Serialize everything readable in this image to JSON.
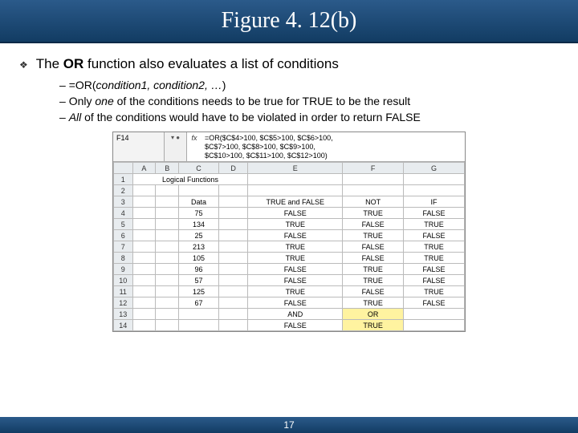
{
  "title": "Figure 4. 12(b)",
  "bullet": {
    "prefix": "The ",
    "bold": "OR",
    "suffix": " function also evaluates a list of conditions"
  },
  "sub": [
    {
      "t1": "=OR(",
      "i1": "condition1, condition2, …",
      "t2": ")"
    },
    {
      "t1": "Only ",
      "i1": "one",
      "t2": " of the conditions needs to be true for TRUE to be the result"
    },
    {
      "t1": "",
      "i1": "All",
      "t2": " of the conditions would have to be violated in order to return FALSE"
    }
  ],
  "fx": {
    "cellref": "F14",
    "ctrl": "▾ ●",
    "label": "fx",
    "formula": "=OR($C$4>100, $C$5>100, $C$6>100,\n$C$7>100, $C$8>100, $C$9>100,\n$C$10>100, $C$11>100, $C$12>100)"
  },
  "sheet": {
    "colhdrs": [
      "A",
      "B",
      "C",
      "D",
      "E",
      "F",
      "G"
    ],
    "rows": [
      {
        "n": "1",
        "a": "Logical Functions",
        "c": "",
        "e": "",
        "f": "",
        "g": "",
        "span": 4
      },
      {
        "n": "2",
        "c": "",
        "e": "",
        "f": "",
        "g": ""
      },
      {
        "n": "3",
        "c": "Data",
        "e": "TRUE and FALSE",
        "f": "NOT",
        "g": "IF"
      },
      {
        "n": "4",
        "c": "75",
        "e": "FALSE",
        "f": "TRUE",
        "g": "FALSE"
      },
      {
        "n": "5",
        "c": "134",
        "e": "TRUE",
        "f": "FALSE",
        "g": "TRUE"
      },
      {
        "n": "6",
        "c": "25",
        "e": "FALSE",
        "f": "TRUE",
        "g": "FALSE"
      },
      {
        "n": "7",
        "c": "213",
        "e": "TRUE",
        "f": "FALSE",
        "g": "TRUE"
      },
      {
        "n": "8",
        "c": "105",
        "e": "TRUE",
        "f": "FALSE",
        "g": "TRUE"
      },
      {
        "n": "9",
        "c": "96",
        "e": "FALSE",
        "f": "TRUE",
        "g": "FALSE"
      },
      {
        "n": "10",
        "c": "57",
        "e": "FALSE",
        "f": "TRUE",
        "g": "FALSE"
      },
      {
        "n": "11",
        "c": "125",
        "e": "TRUE",
        "f": "FALSE",
        "g": "TRUE"
      },
      {
        "n": "12",
        "c": "67",
        "e": "FALSE",
        "f": "TRUE",
        "g": "FALSE"
      },
      {
        "n": "13",
        "c": "",
        "e": "AND",
        "f": "OR",
        "g": "",
        "hlF": true
      },
      {
        "n": "14",
        "c": "",
        "e": "FALSE",
        "f": "TRUE",
        "g": "",
        "hlF": true
      }
    ]
  },
  "page_number": "17"
}
